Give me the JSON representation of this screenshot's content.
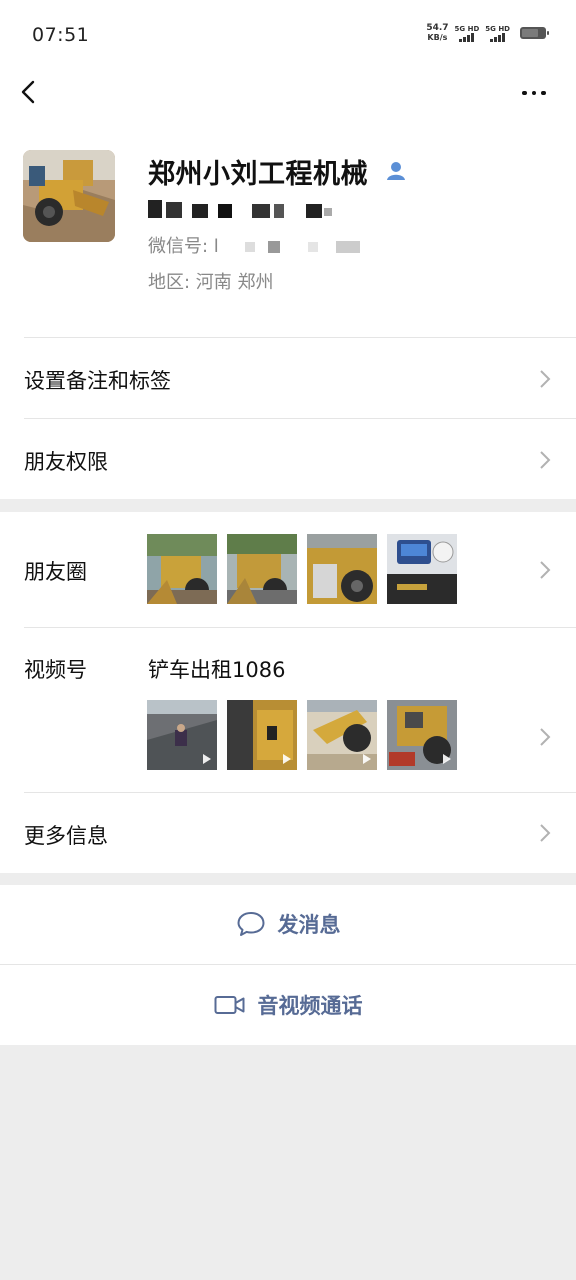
{
  "status_bar": {
    "time": "07:51",
    "net_speed_value": "54.7",
    "net_speed_unit": "KB/s",
    "sim1": "5G HD",
    "sim2": "5G HD"
  },
  "profile": {
    "name": "郑州小刘工程机械",
    "wechat_id_label": "微信号: ",
    "wechat_id_visible": "l",
    "region": "地区:  河南  郑州"
  },
  "menu": {
    "remark_label": "设置备注和标签",
    "permission_label": "朋友权限",
    "moments_label": "朋友圈",
    "channels_label": "视频号",
    "channels_name": "铲车出租1086",
    "more_info_label": "更多信息"
  },
  "actions": {
    "message_label": "发消息",
    "call_label": "音视频通话"
  },
  "colors": {
    "link": "#576b95",
    "background": "#ededed",
    "divider": "#e5e5e5",
    "secondary_text": "#888888"
  },
  "icons": [
    "back-icon",
    "more-icon",
    "person-icon",
    "chevron-right-icon",
    "chat-bubble-icon",
    "video-camera-icon",
    "play-icon"
  ]
}
